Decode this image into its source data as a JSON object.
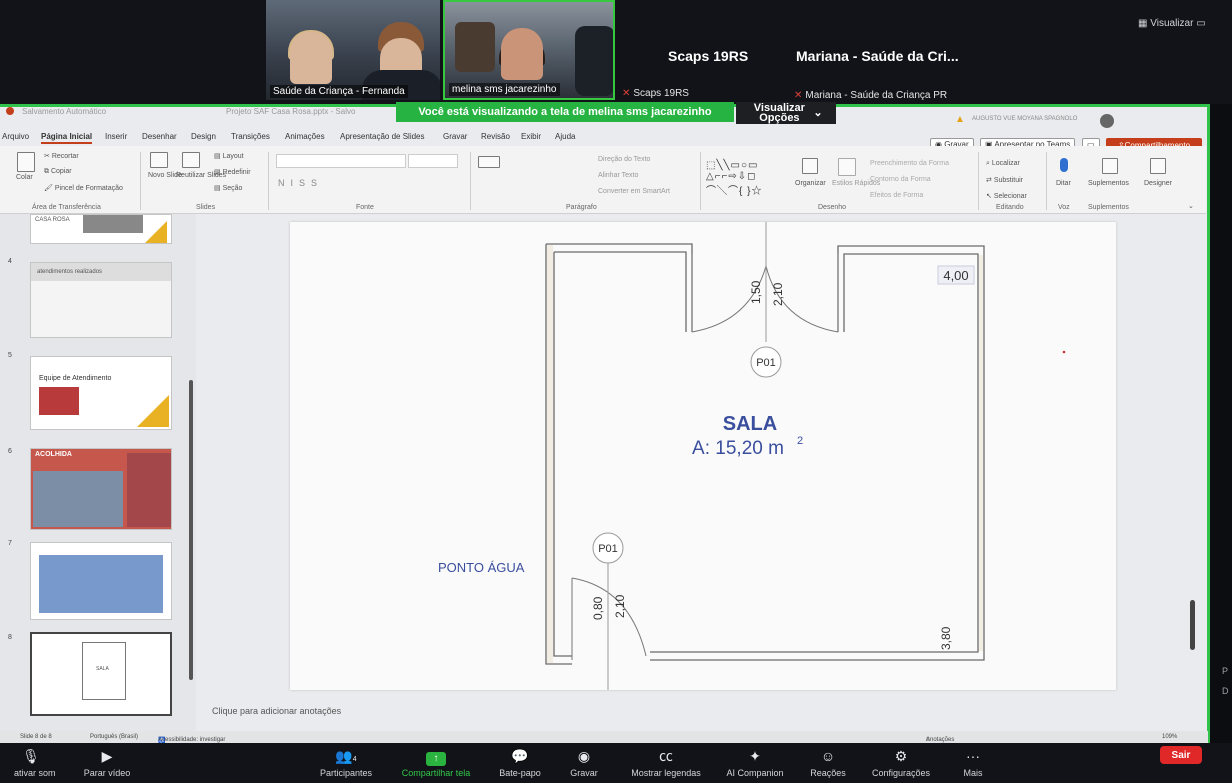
{
  "zoom": {
    "view_button": "Visualizar",
    "participants_tiles": [
      {
        "name": "Saúde da Criança - Fernanda"
      },
      {
        "name": "melina sms jacarezinho"
      }
    ],
    "name_tiles": [
      {
        "title": "Scaps 19RS",
        "sub": "Scaps 19RS"
      },
      {
        "title": "Mariana - Saúde da Cri...",
        "sub": "Mariana - Saúde da Criança PR"
      }
    ],
    "share_banner": "Você está visualizando a tela de  melina sms jacarezinho",
    "view_options": "Visualizar Opções",
    "toolbar": {
      "mute": "ativar som",
      "video": "Parar vídeo",
      "participants": "Participantes",
      "participants_count": "4",
      "share": "Compartilhar tela",
      "chat": "Bate-papo",
      "record": "Gravar",
      "captions": "Mostrar legendas",
      "companion": "AI Companion",
      "reactions": "Reações",
      "settings": "Configurações",
      "more": "Mais",
      "leave": "Sair"
    },
    "right_edge": [
      "P",
      "D"
    ]
  },
  "ppt": {
    "title_text": "Salvamento Automático",
    "doc_name": "Projeto SAF Casa Rosa.pptx - Salvo",
    "menu": [
      "Arquivo",
      "Página Inicial",
      "Inserir",
      "Desenhar",
      "Design",
      "Transições",
      "Animações",
      "Apresentação de Slides",
      "Gravar",
      "Revisão",
      "Exibir",
      "Ajuda"
    ],
    "active_menu": "Página Inicial",
    "right_buttons": {
      "record": "Gravar",
      "teams": "Apresentar no Teams",
      "share": "Compartilhamento"
    },
    "user_label": "AUGUSTO VUE MOYANA SPAGNOLO",
    "ribbon": {
      "clipboard": {
        "paste": "Colar",
        "cut": "Recortar",
        "copy": "Copiar",
        "painter": "Pincel de Formatação",
        "group": "Área de Transferência"
      },
      "slides": {
        "new": "Novo Slide",
        "reuse": "Reutilizar Slides",
        "layout": "Layout",
        "reset": "Redefinir",
        "section": "Seção",
        "group": "Slides"
      },
      "font": {
        "group": "Fonte"
      },
      "paragraph": {
        "dir": "Direção do Texto",
        "align": "Alinhar Texto",
        "smartart": "Converter em SmartArt",
        "group": "Parágrafo"
      },
      "drawing": {
        "arrange": "Organizar",
        "styles": "Estilos Rápidos",
        "fill": "Preenchimento da Forma",
        "outline": "Contorno da Forma",
        "effects": "Efeitos de Forma",
        "group": "Desenho"
      },
      "editing": {
        "find": "Localizar",
        "replace": "Substituir",
        "select": "Selecionar",
        "group": "Editando"
      },
      "voice": {
        "dictate": "Ditar",
        "group": "Voz"
      },
      "addins": {
        "label": "Suplementos",
        "group": "Suplementos"
      },
      "designer": {
        "label": "Designer"
      }
    },
    "thumbnails": [
      {
        "num": "",
        "title": "CASA ROSA"
      },
      {
        "num": "4",
        "title": "atendimentos realizados"
      },
      {
        "num": "5",
        "title": "Equipe de Atendimento"
      },
      {
        "num": "6",
        "title": "ACOLHIDA"
      },
      {
        "num": "7",
        "title": ""
      },
      {
        "num": "8",
        "title": "SALA"
      }
    ],
    "notes_placeholder": "Clique para adicionar anotações",
    "status": {
      "slide": "Slide 8 de 8",
      "lang": "Português (Brasil)",
      "access": "Acessibilidade: investigar",
      "notes": "Anotações",
      "zoom": "109%"
    }
  },
  "floor_plan": {
    "room_name": "SALA",
    "area": "A: 15,20 m",
    "area_sup": "2",
    "dim_right": "4,00",
    "dim_bottom_right": "3,80",
    "door_top_dims": [
      "1,50",
      "2,10"
    ],
    "door_bottom_dims": [
      "0,80",
      "2,10"
    ],
    "door_tag_1": "P01",
    "door_tag_2": "P01",
    "water_point": "PONTO ÁGUA"
  }
}
